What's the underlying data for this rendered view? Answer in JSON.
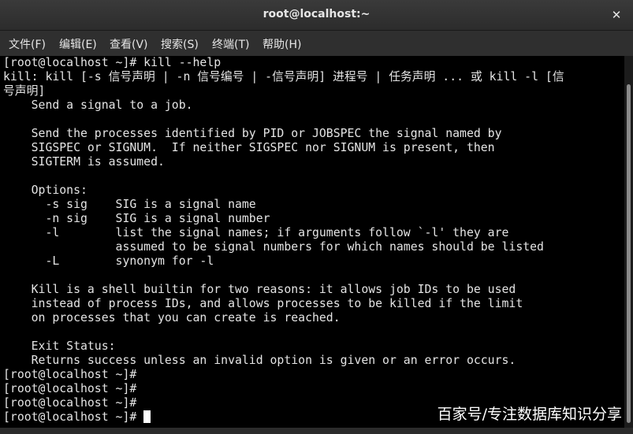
{
  "window": {
    "title": "root@localhost:~",
    "close_glyph": "✕"
  },
  "menubar": {
    "items": [
      "文件(F)",
      "编辑(E)",
      "查看(V)",
      "搜索(S)",
      "终端(T)",
      "帮助(H)"
    ]
  },
  "terminal": {
    "lines": [
      "[root@localhost ~]# kill --help",
      "kill: kill [-s 信号声明 | -n 信号编号 | -信号声明] 进程号 | 任务声明 ... 或 kill -l [信",
      "号声明]",
      "    Send a signal to a job.",
      "",
      "    Send the processes identified by PID or JOBSPEC the signal named by",
      "    SIGSPEC or SIGNUM.  If neither SIGSPEC nor SIGNUM is present, then",
      "    SIGTERM is assumed.",
      "",
      "    Options:",
      "      -s sig    SIG is a signal name",
      "      -n sig    SIG is a signal number",
      "      -l        list the signal names; if arguments follow `-l' they are",
      "                assumed to be signal numbers for which names should be listed",
      "      -L        synonym for -l",
      "",
      "    Kill is a shell builtin for two reasons: it allows job IDs to be used",
      "    instead of process IDs, and allows processes to be killed if the limit",
      "    on processes that you can create is reached.",
      "",
      "    Exit Status:",
      "    Returns success unless an invalid option is given or an error occurs.",
      "[root@localhost ~]#",
      "[root@localhost ~]#",
      "[root@localhost ~]#",
      "[root@localhost ~]#"
    ]
  },
  "watermark": {
    "text": "百家号/专注数据库知识分享"
  },
  "colors": {
    "titlebar": "#2c2c2c",
    "menubar": "#2f2f2f",
    "terminal_bg": "#000000",
    "terminal_fg": "#e4e4e4"
  }
}
